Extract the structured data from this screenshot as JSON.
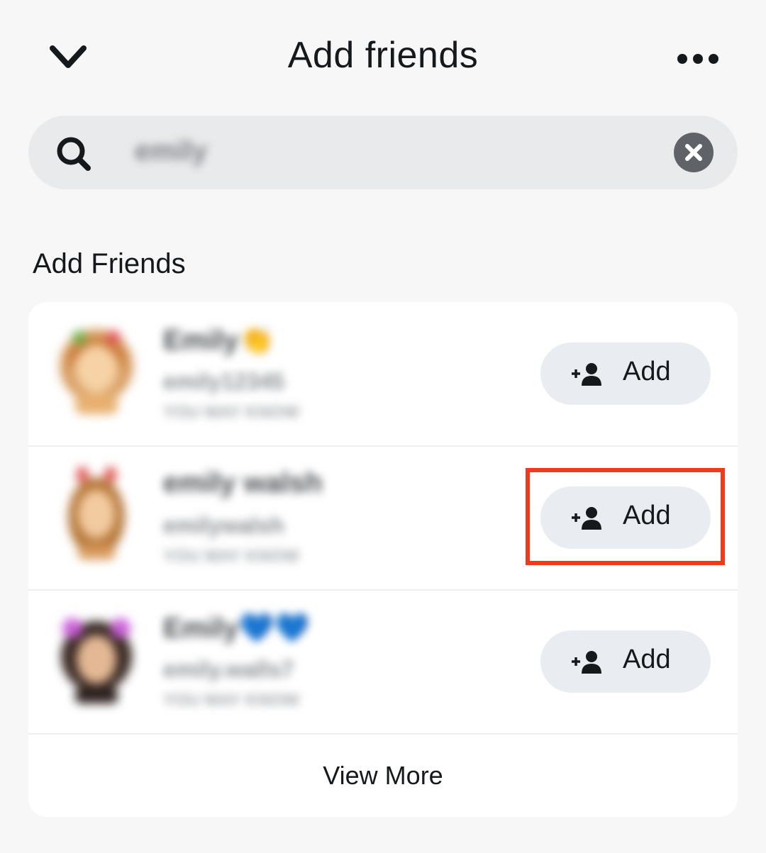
{
  "header": {
    "title": "Add friends",
    "back_icon": "chevron-down-icon",
    "more_icon": "more-horizontal-icon"
  },
  "search": {
    "icon": "search-icon",
    "query": "emily",
    "clear_icon": "close-icon"
  },
  "section": {
    "title": "Add Friends"
  },
  "friends": [
    {
      "display_name": "Emily👏",
      "username": "emily12345",
      "subtitle": "YOU MAY KNOW",
      "add_label": "Add",
      "add_icon": "add-friend-icon"
    },
    {
      "display_name": "emily walsh",
      "username": "emilywalsh",
      "subtitle": "YOU MAY KNOW",
      "add_label": "Add",
      "add_icon": "add-friend-icon"
    },
    {
      "display_name": "Emily💙💙",
      "username": "emily.walls7",
      "subtitle": "YOU MAY KNOW",
      "add_label": "Add",
      "add_icon": "add-friend-icon"
    }
  ],
  "view_more_label": "View More",
  "colors": {
    "background": "#f7f7f8",
    "card": "#ffffff",
    "search_bg": "#e9eaec",
    "button_bg": "#e9ecf0",
    "highlight": "#f0391f",
    "text": "#16191c"
  }
}
